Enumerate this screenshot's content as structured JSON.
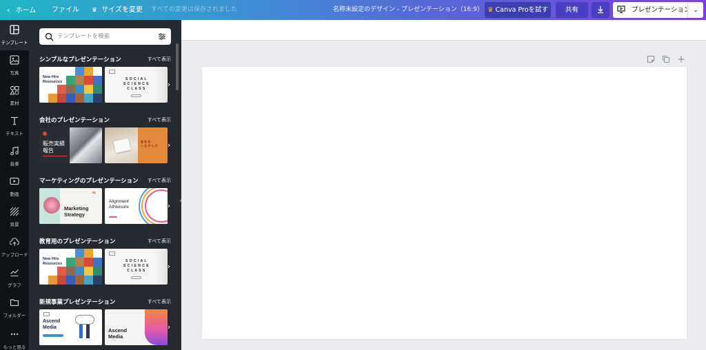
{
  "topbar": {
    "home_label": "ホーム",
    "file_label": "ファイル",
    "resize_label": "サイズを変更",
    "saved_status": "すべての変更は保存されました",
    "doc_title": "名称未設定のデザイン - プレゼンテーション（16:9）",
    "pro_label": "Canva Proを試す",
    "share_label": "共有",
    "present_label": "プレゼンテーション",
    "gradient_start": "#1fb5c4",
    "gradient_end": "#7b3fe0"
  },
  "rail": [
    {
      "label": "テンプレート",
      "icon": "template-icon"
    },
    {
      "label": "写真",
      "icon": "photo-icon"
    },
    {
      "label": "素材",
      "icon": "elements-icon"
    },
    {
      "label": "テキスト",
      "icon": "text-icon"
    },
    {
      "label": "音楽",
      "icon": "music-icon"
    },
    {
      "label": "動画",
      "icon": "video-icon"
    },
    {
      "label": "背景",
      "icon": "background-icon"
    },
    {
      "label": "アップロード",
      "icon": "upload-icon"
    },
    {
      "label": "グラフ",
      "icon": "chart-icon"
    },
    {
      "label": "フォルダー",
      "icon": "folder-icon"
    },
    {
      "label": "もっと見る",
      "icon": "more-icon"
    }
  ],
  "panel": {
    "search_placeholder": "テンプレートを検索",
    "see_all_label": "すべて表示",
    "sections": [
      {
        "title": "シンプルなプレゼンテーション"
      },
      {
        "title": "会社のプレゼンテーション"
      },
      {
        "title": "マーケティングのプレゼンテーション"
      },
      {
        "title": "教育用のプレゼンテーション"
      },
      {
        "title": "新規事業プレゼンテーション"
      }
    ]
  },
  "thumbs": {
    "new_hire_line1": "New Hire",
    "new_hire_line2": "Resources",
    "social_line1": "S O C I A L",
    "social_line2": "S C I E N C E",
    "social_line3": "C L A S S",
    "sales_line1": "販売実績",
    "sales_line2": "報告",
    "orange_line1": "会 社 な",
    "orange_line2": "ー ス ラ ン ズ",
    "marketing_line1": "Marketing",
    "marketing_line2": "Strategy",
    "marketing_number": "01",
    "alignment_line1": "Alignment",
    "alignment_line2": "Athleisure",
    "ascend_line1": "Ascend",
    "ascend_line2": "Media"
  }
}
